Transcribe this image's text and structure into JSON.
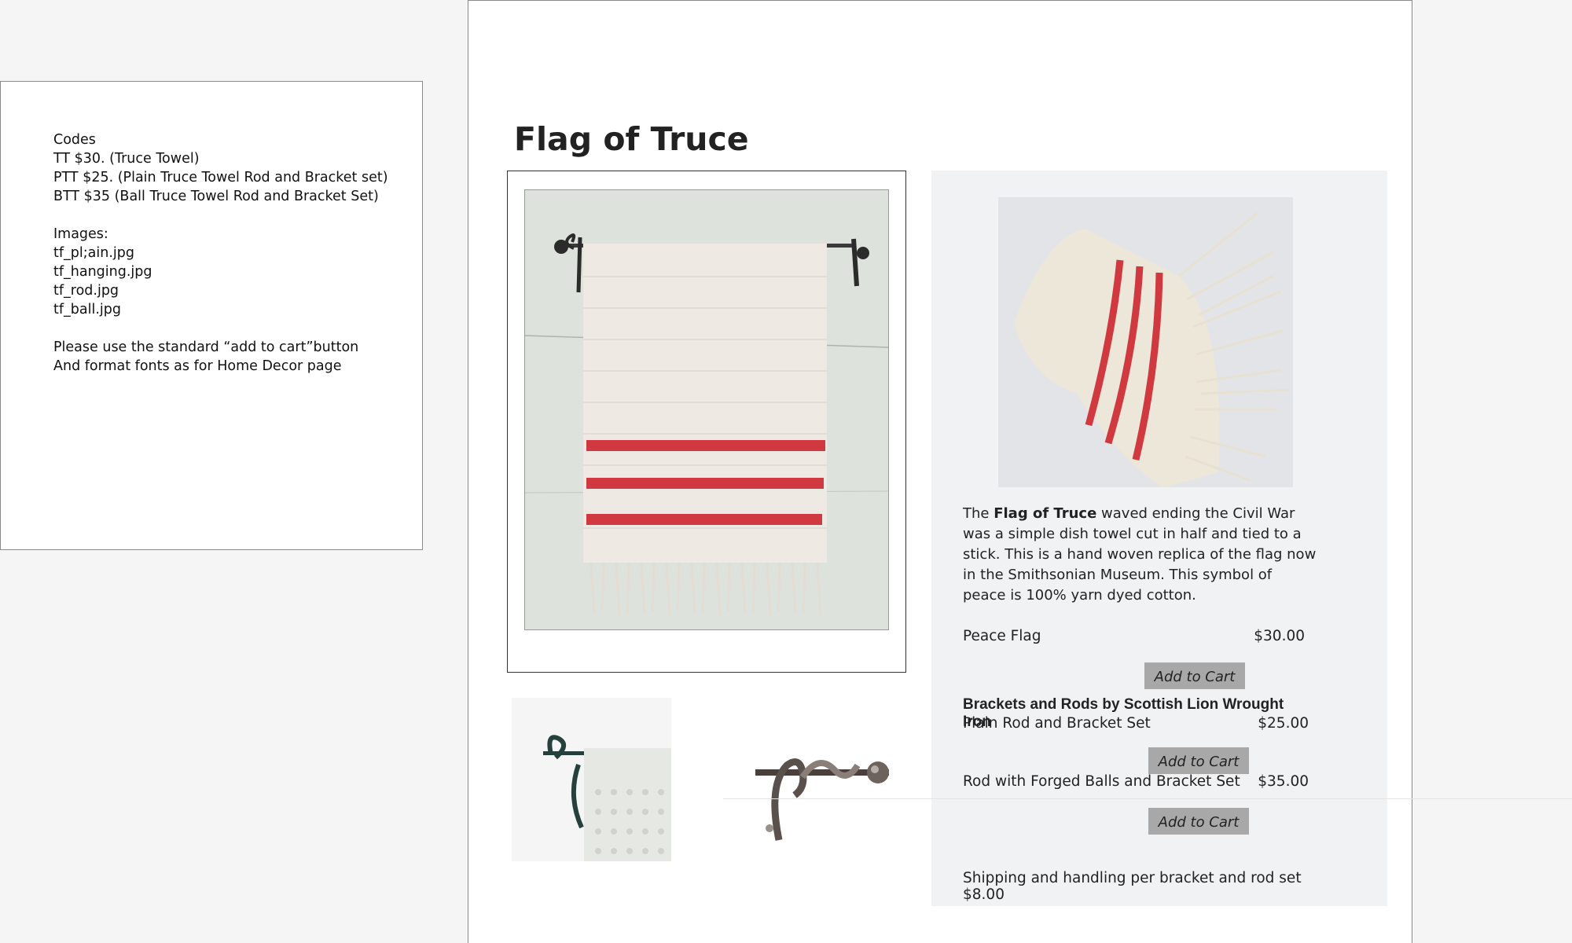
{
  "notes": {
    "lines": [
      "Codes",
      "TT $30. (Truce Towel)",
      "PTT $25. (Plain Truce Towel Rod and Bracket set)",
      "BTT $35 (Ball Truce Towel Rod and Bracket Set)",
      "",
      "Images:",
      "tf_pl;ain.jpg",
      "tf_hanging.jpg",
      "tf_rod.jpg",
      "tf_ball.jpg",
      "",
      "Please use the standard “add to cart”button",
      "And format fonts as for Home Decor page"
    ]
  },
  "page": {
    "title": "Flag of Truce",
    "description": {
      "pre": "The ",
      "bold": "Flag of Truce",
      "post": " waved ending the Civil War was a simple dish towel cut in half and tied to a stick. This is a hand woven replica of the flag now in the Smithsonian Museum. This symbol of peace is 100% yarn dyed cotton."
    },
    "products": {
      "peace_flag": {
        "name": "Peace Flag",
        "price": "$30.00",
        "button": "Add to Cart"
      },
      "section_header": "Brackets and Rods by Scottish Lion Wrought Iron",
      "plain_rod": {
        "name": "Plain Rod and Bracket Set",
        "price": "$25.00",
        "button": "Add to Cart"
      },
      "ball_rod": {
        "name": "Rod with Forged Balls and Bracket Set",
        "price": "$35.00",
        "button": "Add to Cart"
      }
    },
    "shipping": "Shipping and handling per bracket and rod set $8.00"
  },
  "colors": {
    "stripe_red": "#d0393f",
    "towel_cream": "#efeae0",
    "button_gray": "#a8a8a8",
    "panel_bg": "#f1f2f4"
  }
}
